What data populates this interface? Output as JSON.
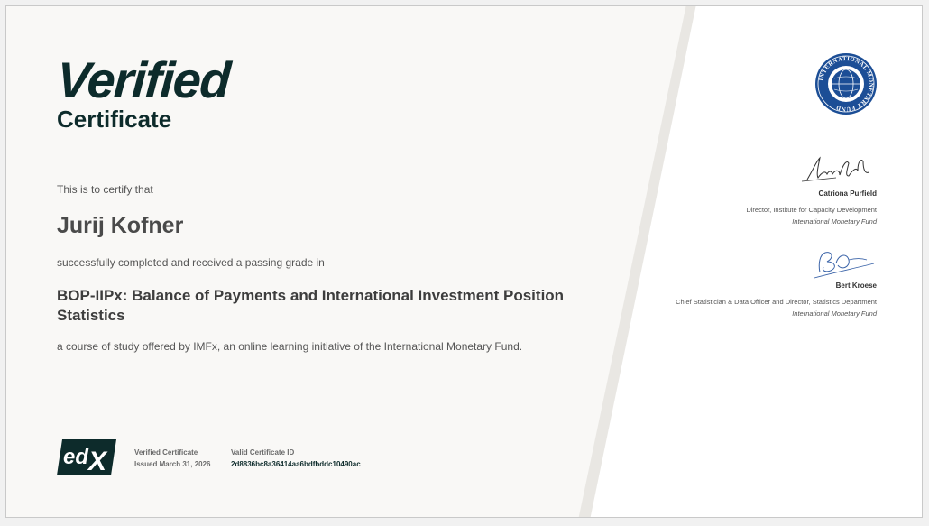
{
  "title": {
    "main": "Verified",
    "sub": "Certificate"
  },
  "certify_text": "This is to certify that",
  "recipient_name": "Jurij Kofner",
  "completed_text": "successfully completed and received a passing grade in",
  "course_title": "BOP-IIPx: Balance of Payments and International Investment Position Statistics",
  "offered_text": "a course of study offered by IMFx, an online learning initiative of the International Monetary Fund.",
  "footer": {
    "logo_text": "edX",
    "cert_type_label": "Verified Certificate",
    "issued": "Issued March 31, 2026",
    "cert_id_label": "Valid Certificate ID",
    "cert_id": "2d8836bc8a36414aa6bdfbddc10490ac"
  },
  "seal": {
    "text": "INTERNATIONAL MONETARY FUND"
  },
  "signatories": [
    {
      "name": "Catriona Purfield",
      "title": "Director, Institute for Capacity Development",
      "organization": "International Monetary Fund"
    },
    {
      "name": "Bert Kroese",
      "title": "Chief Statistician & Data Officer and Director, Statistics Department",
      "organization": "International Monetary Fund"
    }
  ],
  "colors": {
    "brand_dark": "#0d2b2b",
    "seal_blue": "#1c4e96",
    "signature_blue": "#3a63a8"
  }
}
